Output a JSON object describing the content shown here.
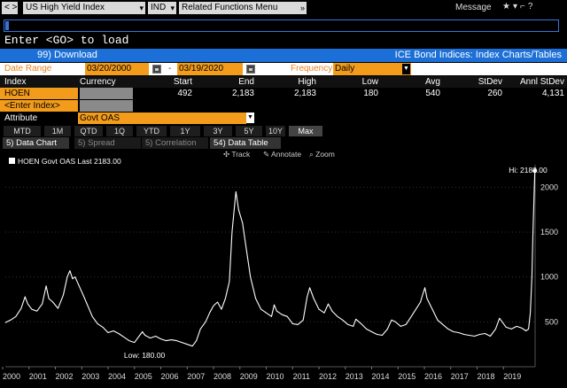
{
  "toolbar": {
    "security": "US High Yield Index",
    "market": "IND",
    "related": "Related Functions Menu",
    "message": "Message",
    "icons": [
      "star-icon",
      "settings-icon",
      "dashes-icon",
      "help-icon"
    ]
  },
  "command": {
    "prompt": "Enter <GO> to load"
  },
  "header": {
    "download": "99) Download",
    "title": "ICE Bond Indices: Index Charts/Tables"
  },
  "filters": {
    "date_range_label": "Date Range",
    "start_date": "03/20/2000",
    "separator": "-",
    "end_date": "03/19/2020",
    "frequency_label": "Frequency",
    "frequency_value": "Daily"
  },
  "stats": {
    "headers": [
      "Index",
      "Currency",
      "Start",
      "End",
      "High",
      "Low",
      "Avg",
      "StDev",
      "Annl StDev"
    ],
    "row": {
      "index": "HOEN",
      "currency": "",
      "start": "492",
      "end": "2,183",
      "high": "2,183",
      "low": "180",
      "avg": "540",
      "stdev": "260",
      "annl_stdev": "4,131"
    },
    "enter_index": "<Enter Index>",
    "attribute_label": "Attribute",
    "attribute_value": "Govt OAS"
  },
  "periods": [
    "MTD",
    "1M",
    "QTD",
    "1Q",
    "YTD",
    "1Y",
    "3Y",
    "5Y",
    "10Y",
    "Max"
  ],
  "active_period": "Max",
  "tabs": [
    "5) Data Chart",
    "5) Spread",
    "5) Correlation",
    "54) Data Table"
  ],
  "chart_tools": {
    "track": "Track",
    "annotate": "Annotate",
    "zoom": "Zoom"
  },
  "chart_data": {
    "type": "line",
    "legend": "HOEN Govt OAS Last 2183.00",
    "hi_label": "Hi: 2183.00",
    "low_label": "Low: 180.00",
    "x_ticks": [
      "2000",
      "2001",
      "2002",
      "2003",
      "2004",
      "2005",
      "2006",
      "2007",
      "2008",
      "2009",
      "2010",
      "2011",
      "2012",
      "2013",
      "2014",
      "2015",
      "2016",
      "2017",
      "2018",
      "2019"
    ],
    "y_ticks": [
      500,
      1000,
      1500,
      2000
    ],
    "ylim": [
      0,
      2250
    ],
    "xlim": [
      2000.2,
      2020.3
    ],
    "series": [
      {
        "name": "HOEN Govt OAS",
        "color": "#ffffff",
        "points": [
          [
            2000.2,
            492
          ],
          [
            2000.4,
            520
          ],
          [
            2000.6,
            560
          ],
          [
            2000.8,
            650
          ],
          [
            2000.95,
            780
          ],
          [
            2001.05,
            700
          ],
          [
            2001.2,
            640
          ],
          [
            2001.4,
            620
          ],
          [
            2001.6,
            700
          ],
          [
            2001.75,
            900
          ],
          [
            2001.85,
            760
          ],
          [
            2002.0,
            720
          ],
          [
            2002.2,
            650
          ],
          [
            2002.4,
            800
          ],
          [
            2002.55,
            1000
          ],
          [
            2002.65,
            1070
          ],
          [
            2002.75,
            980
          ],
          [
            2002.85,
            1000
          ],
          [
            2003.0,
            900
          ],
          [
            2003.15,
            800
          ],
          [
            2003.3,
            700
          ],
          [
            2003.5,
            560
          ],
          [
            2003.7,
            480
          ],
          [
            2003.9,
            440
          ],
          [
            2004.1,
            380
          ],
          [
            2004.3,
            400
          ],
          [
            2004.5,
            370
          ],
          [
            2004.7,
            330
          ],
          [
            2004.9,
            290
          ],
          [
            2005.1,
            270
          ],
          [
            2005.25,
            330
          ],
          [
            2005.4,
            390
          ],
          [
            2005.5,
            350
          ],
          [
            2005.7,
            320
          ],
          [
            2005.9,
            340
          ],
          [
            2006.1,
            310
          ],
          [
            2006.3,
            290
          ],
          [
            2006.5,
            300
          ],
          [
            2006.7,
            290
          ],
          [
            2006.9,
            270
          ],
          [
            2007.1,
            250
          ],
          [
            2007.3,
            230
          ],
          [
            2007.45,
            290
          ],
          [
            2007.6,
            420
          ],
          [
            2007.8,
            500
          ],
          [
            2007.95,
            600
          ],
          [
            2008.1,
            680
          ],
          [
            2008.25,
            720
          ],
          [
            2008.4,
            640
          ],
          [
            2008.55,
            760
          ],
          [
            2008.7,
            950
          ],
          [
            2008.8,
            1500
          ],
          [
            2008.9,
            1800
          ],
          [
            2008.95,
            1950
          ],
          [
            2009.05,
            1750
          ],
          [
            2009.2,
            1600
          ],
          [
            2009.35,
            1300
          ],
          [
            2009.5,
            1000
          ],
          [
            2009.7,
            760
          ],
          [
            2009.9,
            640
          ],
          [
            2010.1,
            600
          ],
          [
            2010.3,
            560
          ],
          [
            2010.4,
            690
          ],
          [
            2010.5,
            620
          ],
          [
            2010.7,
            580
          ],
          [
            2010.9,
            560
          ],
          [
            2011.1,
            480
          ],
          [
            2011.3,
            470
          ],
          [
            2011.5,
            520
          ],
          [
            2011.65,
            780
          ],
          [
            2011.75,
            880
          ],
          [
            2011.9,
            760
          ],
          [
            2012.1,
            640
          ],
          [
            2012.3,
            600
          ],
          [
            2012.45,
            700
          ],
          [
            2012.6,
            620
          ],
          [
            2012.8,
            560
          ],
          [
            2013.0,
            520
          ],
          [
            2013.2,
            470
          ],
          [
            2013.4,
            450
          ],
          [
            2013.5,
            530
          ],
          [
            2013.7,
            480
          ],
          [
            2013.9,
            420
          ],
          [
            2014.1,
            390
          ],
          [
            2014.3,
            360
          ],
          [
            2014.5,
            350
          ],
          [
            2014.7,
            420
          ],
          [
            2014.85,
            520
          ],
          [
            2015.0,
            500
          ],
          [
            2015.2,
            450
          ],
          [
            2015.4,
            470
          ],
          [
            2015.6,
            560
          ],
          [
            2015.8,
            650
          ],
          [
            2015.95,
            720
          ],
          [
            2016.05,
            820
          ],
          [
            2016.12,
            880
          ],
          [
            2016.2,
            760
          ],
          [
            2016.4,
            640
          ],
          [
            2016.6,
            520
          ],
          [
            2016.8,
            470
          ],
          [
            2017.0,
            420
          ],
          [
            2017.2,
            390
          ],
          [
            2017.4,
            380
          ],
          [
            2017.6,
            360
          ],
          [
            2017.8,
            350
          ],
          [
            2018.0,
            340
          ],
          [
            2018.2,
            360
          ],
          [
            2018.4,
            370
          ],
          [
            2018.6,
            340
          ],
          [
            2018.8,
            420
          ],
          [
            2018.95,
            540
          ],
          [
            2019.05,
            500
          ],
          [
            2019.2,
            440
          ],
          [
            2019.4,
            420
          ],
          [
            2019.6,
            450
          ],
          [
            2019.8,
            430
          ],
          [
            2019.95,
            400
          ],
          [
            2020.05,
            420
          ],
          [
            2020.12,
            600
          ],
          [
            2020.18,
            1000
          ],
          [
            2020.22,
            1500
          ],
          [
            2020.26,
            1900
          ],
          [
            2020.29,
            2183
          ]
        ]
      }
    ]
  }
}
